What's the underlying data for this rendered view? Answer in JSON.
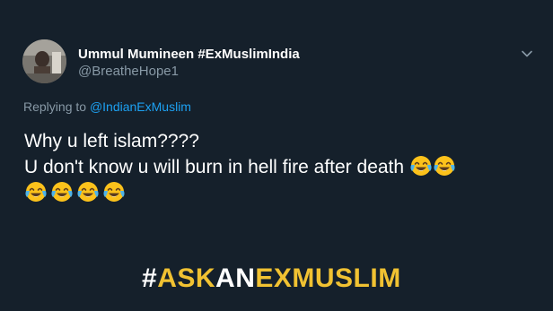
{
  "tweet": {
    "author": {
      "display_name": "Ummul Mumineen #ExMuslimIndia",
      "handle": "@BreatheHope1"
    },
    "reply": {
      "prefix": "Replying to",
      "mention": "@IndianExMuslim"
    },
    "text": {
      "line1": "Why u left islam????",
      "line2": "U don't know u will burn in hell fire after death",
      "emoji_inline_count": 2,
      "emoji_row_count": 4,
      "emoji_icon": "face-with-tears-of-joy-icon"
    }
  },
  "overlay": {
    "hashtag_symbol": "#",
    "hashtag_part1": "ASK",
    "hashtag_part2": "AN",
    "hashtag_part3": "EXMUSLIM",
    "colors": {
      "yellow": "#f1c232",
      "white": "#ffffff"
    }
  },
  "theme": {
    "background": "#15202b",
    "link_blue": "#1da1f2",
    "secondary_text": "#8899a6"
  }
}
